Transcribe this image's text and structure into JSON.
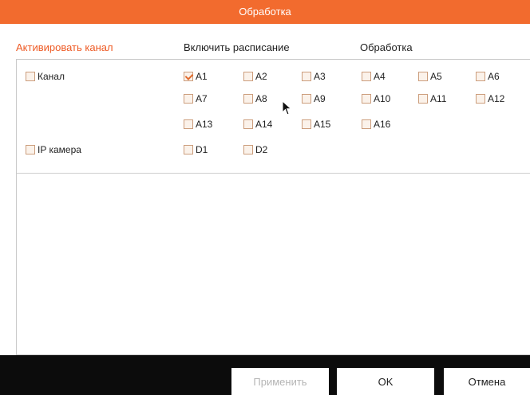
{
  "window": {
    "title": "Обработка"
  },
  "tabs": [
    {
      "label": "Активировать канал",
      "active": true
    },
    {
      "label": "Включить расписание",
      "active": false
    },
    {
      "label": "Обработка",
      "active": false
    }
  ],
  "channel_group": {
    "label": "Канал",
    "checked": false,
    "channels": [
      {
        "label": "A1",
        "checked": true
      },
      {
        "label": "A2",
        "checked": false
      },
      {
        "label": "A3",
        "checked": false
      },
      {
        "label": "A4",
        "checked": false
      },
      {
        "label": "A5",
        "checked": false
      },
      {
        "label": "A6",
        "checked": false
      },
      {
        "label": "A7",
        "checked": false
      },
      {
        "label": "A8",
        "checked": false
      },
      {
        "label": "A9",
        "checked": false
      },
      {
        "label": "A10",
        "checked": false
      },
      {
        "label": "A11",
        "checked": false
      },
      {
        "label": "A12",
        "checked": false
      },
      {
        "label": "A13",
        "checked": false
      },
      {
        "label": "A14",
        "checked": false
      },
      {
        "label": "A15",
        "checked": false
      },
      {
        "label": "A16",
        "checked": false
      }
    ]
  },
  "ip_camera_group": {
    "label": "IP камера",
    "checked": false,
    "channels": [
      {
        "label": "D1",
        "checked": false
      },
      {
        "label": "D2",
        "checked": false
      }
    ]
  },
  "footer": {
    "apply_label": "Применить",
    "ok_label": "OK",
    "cancel_label": "Отмена"
  },
  "colors": {
    "accent": "#f26b2e",
    "footer_bg": "#0c0c0c"
  }
}
